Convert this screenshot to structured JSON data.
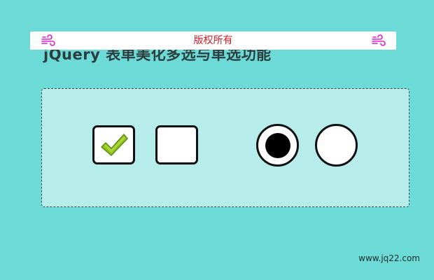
{
  "page": {
    "title": "jQuery 表单美化多选与单选功能",
    "background": "#6cdad6"
  },
  "banner": {
    "text": "版权所有",
    "text_color": "#d81e28",
    "icon": "wind-icon",
    "icon_color": "#e020d0"
  },
  "form": {
    "checkboxes": [
      {
        "checked": true
      },
      {
        "checked": false
      }
    ],
    "radios": [
      {
        "selected": true
      },
      {
        "selected": false
      }
    ],
    "check_color": "#8ec21f"
  },
  "footer": {
    "link_text": "www.jq22.com"
  }
}
